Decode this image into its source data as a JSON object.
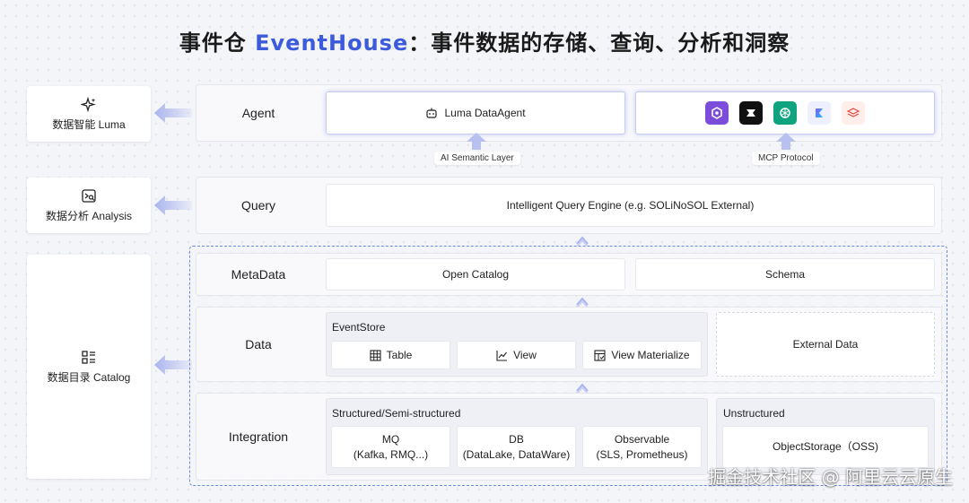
{
  "title": {
    "main": "事件仓 ",
    "accent": "EventHouse",
    "rest": "：事件数据的存储、查询、分析和洞察"
  },
  "left": {
    "luma": {
      "label": "数据智能 Luma",
      "icon": "sparkle-icon"
    },
    "analysis": {
      "label": "数据分析 Analysis",
      "icon": "analysis-icon"
    },
    "catalog": {
      "label": "数据目录 Catalog",
      "icon": "catalog-icon"
    }
  },
  "rows": {
    "agent": "Agent",
    "query": "Query",
    "metadata": "MetaData",
    "data": "Data",
    "integration": "Integration"
  },
  "agent": {
    "luma_agent": "Luma DataAgent",
    "semantic_layer": "AI Semantic Layer",
    "mcp": "MCP Protocol",
    "logos": [
      "purple-logo-icon",
      "black-logo-icon",
      "openai-logo-icon",
      "gradient-logo-icon",
      "layers-logo-icon"
    ]
  },
  "query": {
    "engine": "Intelligent Query Engine (e.g. SOLiNoSOL External)"
  },
  "metadata": {
    "catalog": "Open Catalog",
    "schema": "Schema"
  },
  "data": {
    "eventstore": "EventStore",
    "table": "Table",
    "view": "View",
    "view_materialize": "View Materialize",
    "external": "External Data"
  },
  "integration": {
    "structured": "Structured/Semi-structured",
    "mq": {
      "line1": "MQ",
      "line2": "(Kafka, RMQ...)"
    },
    "db": {
      "line1": "DB",
      "line2": "(DataLake, DataWare)"
    },
    "observable": {
      "line1": "Observable",
      "line2": "(SLS, Prometheus)"
    },
    "unstructured": "Unstructured",
    "object_storage": "ObjectStorage（OSS)"
  },
  "watermark": "掘金技术社区 @ 阿里云云原生",
  "colors": {
    "accent": "#3b5bdb",
    "arrow": "#aab4ee",
    "frame": "#6f8be0"
  }
}
